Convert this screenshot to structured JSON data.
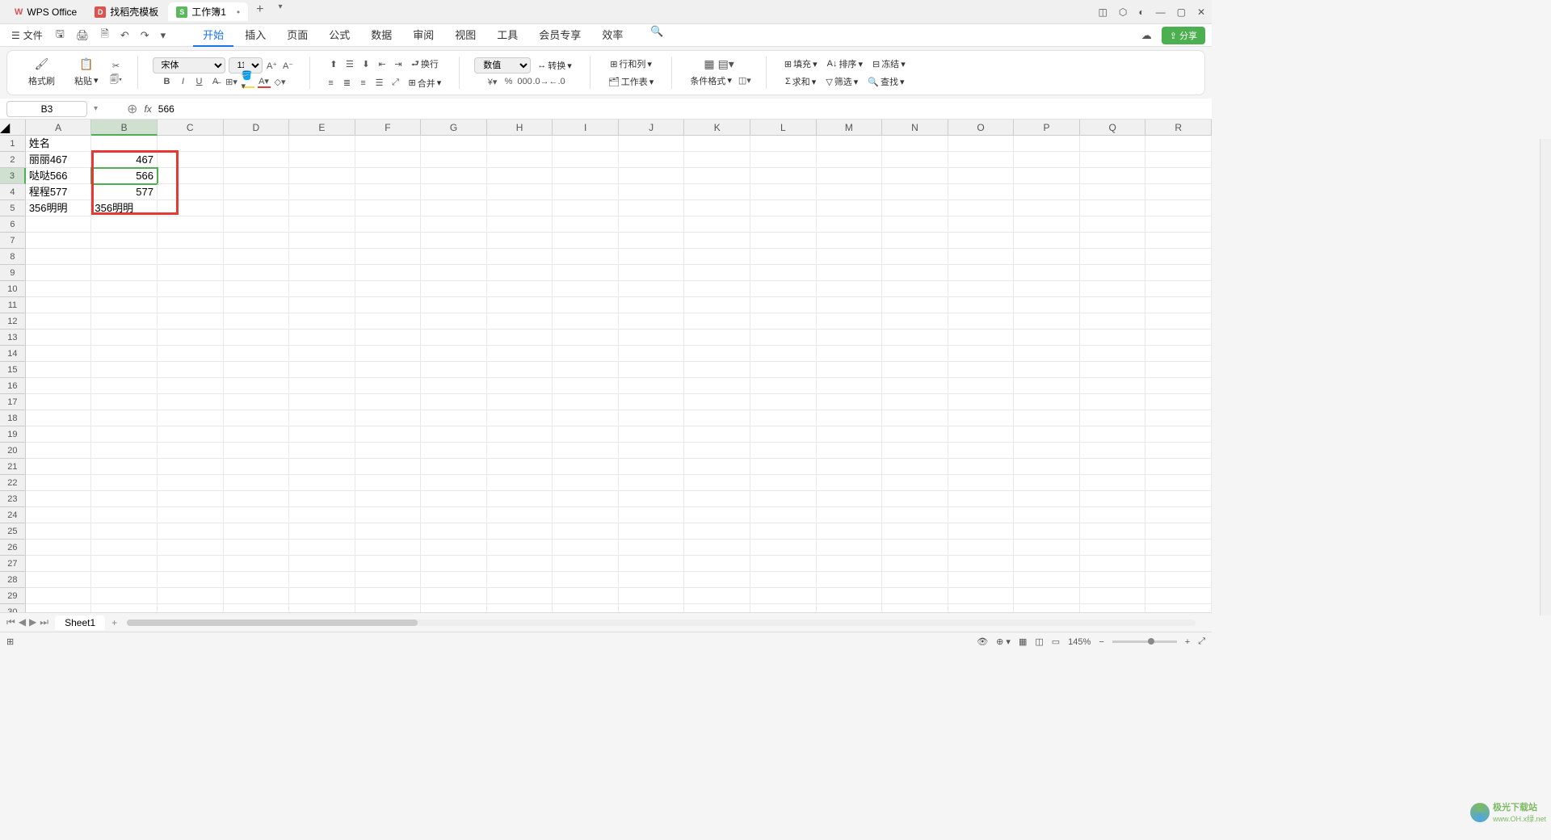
{
  "titlebar": {
    "app": "WPS Office",
    "tab2": "找稻壳模板",
    "tab3": "工作簿1"
  },
  "menu": {
    "file": "文件",
    "tabs": [
      "开始",
      "插入",
      "页面",
      "公式",
      "数据",
      "审阅",
      "视图",
      "工具",
      "会员专享",
      "效率"
    ]
  },
  "ribbon": {
    "format_painter": "格式刷",
    "paste": "粘贴",
    "font_name": "宋体",
    "font_size": "11",
    "wrap": "换行",
    "number_format": "数值",
    "convert": "转换",
    "row_col": "行和列",
    "worksheet": "工作表",
    "cond_format": "条件格式",
    "merge": "合并",
    "fill": "填充",
    "sort": "排序",
    "freeze": "冻结",
    "sum": "求和",
    "filter": "筛选",
    "find": "查找"
  },
  "formula": {
    "cell_ref": "B3",
    "value": "566"
  },
  "columns": [
    "A",
    "B",
    "C",
    "D",
    "E",
    "F",
    "G",
    "H",
    "I",
    "J",
    "K",
    "L",
    "M",
    "N",
    "O",
    "P",
    "Q",
    "R"
  ],
  "cells": {
    "A1": "姓名",
    "A2": "丽丽467",
    "A3": "哒哒566",
    "A4": "程程577",
    "A5": "356明明",
    "B2": "467",
    "B3": "566",
    "B4": "577",
    "B5": "356明明"
  },
  "sheet": {
    "name": "Sheet1"
  },
  "status": {
    "zoom": "145%"
  },
  "watermark": {
    "line1": "极光下载站",
    "line2": "www.OH.x绿.net"
  }
}
